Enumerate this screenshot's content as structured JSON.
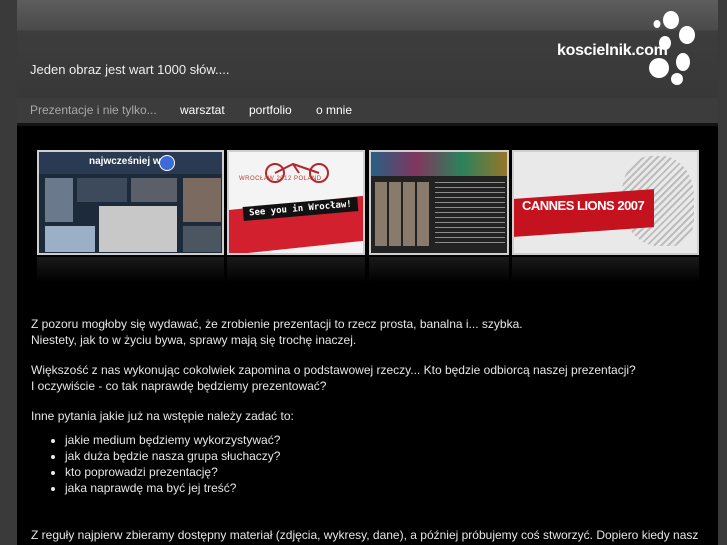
{
  "header": {
    "tagline": "Jeden obraz jest wart 1000 słów....",
    "logo": "koscielnik.com"
  },
  "nav": {
    "items": [
      {
        "label": "Prezentacje i nie tylko..."
      },
      {
        "label": "warsztat"
      },
      {
        "label": "portfolio"
      },
      {
        "label": "o mnie"
      }
    ]
  },
  "gallery": {
    "thumb1": {
      "title": "najwcześniej w"
    },
    "thumb2": {
      "headline": "WROCŁAW 2012 POLAND",
      "sign": "See you in Wrocław!"
    },
    "thumb4": {
      "text": "CANNES LIONS 2007"
    }
  },
  "article": {
    "p1_line1": "Z pozoru mogłoby się wydawać, że zrobienie prezentacji to rzecz prosta, banalna i... szybka.",
    "p1_line2": "Niestety, jak to w życiu bywa, sprawy mają się trochę inaczej.",
    "p2_line1": "Większość z nas wykonując cokolwiek zapomina o podstawowej rzeczy... Kto będzie odbiorcą naszej prezentacji?",
    "p2_line2": "I oczywiście - co tak naprawdę będziemy prezentować?",
    "p3": "Inne pytania jakie już na wstępie należy zadać to:",
    "questions": [
      "jakie medium będziemy wykorzystywać?",
      "jak duża będzie nasza grupa słuchaczy?",
      "kto poprowadzi prezentację?",
      "jaka naprawdę ma być jej treść?"
    ],
    "p4": "Z reguły najpierw zbieramy dostępny materiał (zdjęcia, wykresy, dane), a później próbujemy coś stworzyć. Dopiero kiedy nasz"
  }
}
